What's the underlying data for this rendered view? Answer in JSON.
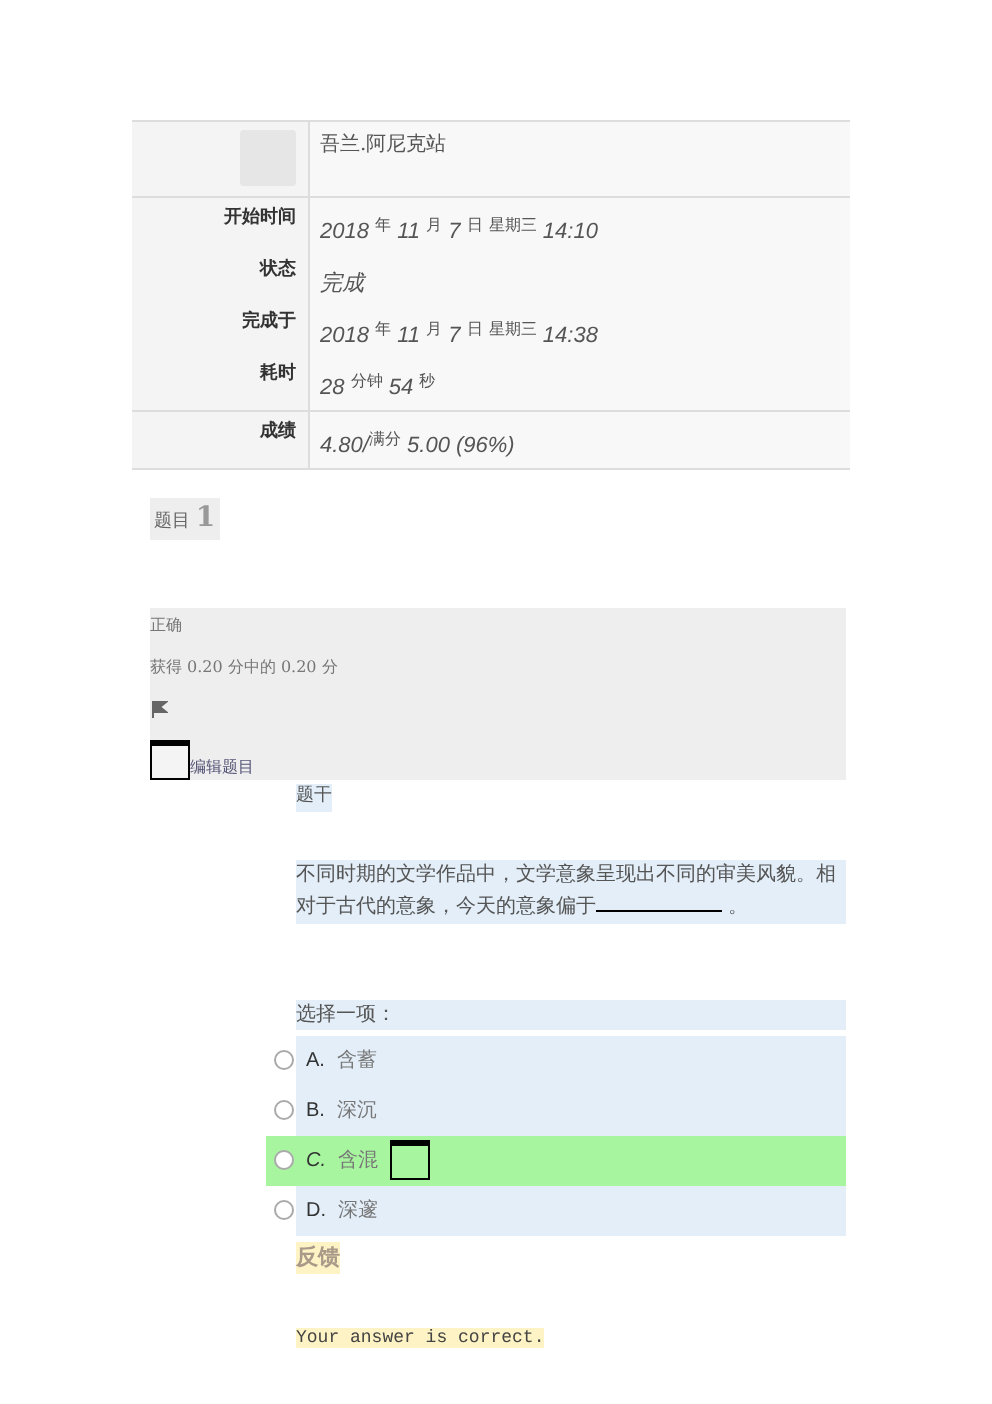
{
  "summary": {
    "user": {
      "name": "吾兰.阿尼克站"
    },
    "groups": [
      [
        {
          "label": "开始时间",
          "value": "2018 $^{年}$ 11 $^{月}$ 7 $^{日}$  $^{星期三}$  14:10"
        },
        {
          "label": "状态",
          "value": "完成"
        },
        {
          "label": "完成于",
          "value": "2018 $^{年}$ 11 $^{月}$ 7 $^{日}$  $^{星期三}$  14:38"
        },
        {
          "label": "耗时",
          "value": "28 $^{分钟}$ 54 $^{秒}$"
        }
      ],
      [
        {
          "label": "成绩",
          "value": "4.80/$^{满分}$ 5.00 (96%)"
        }
      ]
    ]
  },
  "question": {
    "heading_label": "题目",
    "number": "1",
    "info": {
      "status": "正确",
      "mark": "获得 0.20 分中的 0.20 分",
      "edit_link": "编辑题目"
    },
    "stem_label": "题干",
    "text": "不同时期的文学作品中，文学意象呈现出不同的审美风貌。相对于古代的意象，今天的意象偏于",
    "text_end": "。",
    "prompt": "选择一项：",
    "options": [
      {
        "letter": "A.",
        "text": "含蓄",
        "selected": false,
        "correct": false
      },
      {
        "letter": "B.",
        "text": "深沉",
        "selected": false,
        "correct": false
      },
      {
        "letter": "C.",
        "text": "含混",
        "selected": false,
        "correct": true
      },
      {
        "letter": "D.",
        "text": "深邃",
        "selected": false,
        "correct": false
      }
    ],
    "feedback_label": "反馈",
    "feedback": "Your answer is correct."
  }
}
